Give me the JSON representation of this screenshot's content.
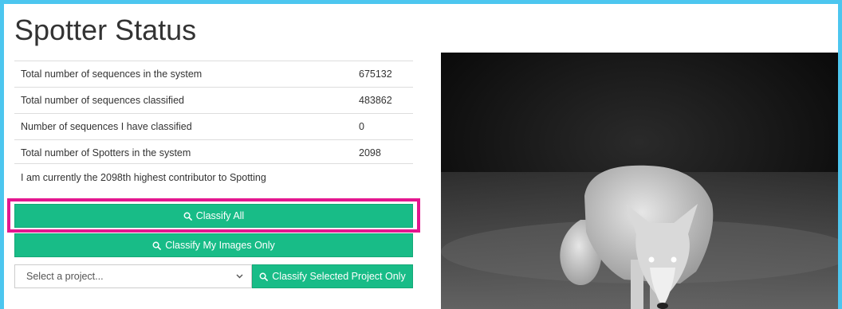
{
  "title": "Spotter Status",
  "stats": [
    {
      "label": "Total number of sequences in the system",
      "value": "675132"
    },
    {
      "label": "Total number of sequences classified",
      "value": "483862"
    },
    {
      "label": "Number of sequences I have classified",
      "value": "0"
    },
    {
      "label": "Total number of Spotters in the system",
      "value": "2098"
    }
  ],
  "contributor_text": "I am currently the 2098th highest contributor to Spotting",
  "buttons": {
    "classify_all": "Classify All",
    "classify_my": "Classify My Images Only",
    "classify_project": "Classify Selected Project Only"
  },
  "project_select": {
    "selected": "Select a project..."
  },
  "icons": {
    "search": "search-icon",
    "dropdown": "chevron-down-icon"
  },
  "colors": {
    "accent": "#18bc87",
    "highlight": "#e4168f",
    "frame": "#4cc6ef"
  }
}
